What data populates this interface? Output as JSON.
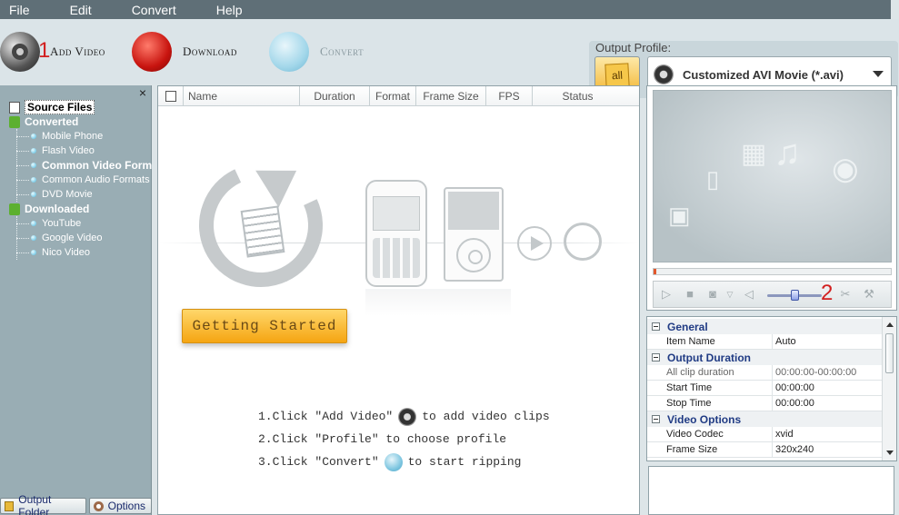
{
  "menu": {
    "items": [
      "File",
      "Edit",
      "Convert",
      "Help"
    ]
  },
  "toolbar": {
    "add_video_label": "Add Video",
    "add_video_step": "1",
    "download_label": "Download",
    "convert_label": "Convert"
  },
  "profile": {
    "caption": "Output Profile:",
    "all_button": "all",
    "selected": "Customized AVI Movie (*.avi)"
  },
  "sidebar": {
    "close": "×",
    "source_files": "Source Files",
    "converted": {
      "label": "Converted",
      "items": [
        "Mobile Phone",
        "Flash Video",
        "Common Video Form",
        "Common Audio Formats",
        "DVD Movie"
      ]
    },
    "downloaded": {
      "label": "Downloaded",
      "items": [
        "YouTube",
        "Google Video",
        "Nico Video"
      ]
    },
    "output_folder": "Output Folder",
    "options": "Options"
  },
  "file_list": {
    "columns": [
      "Name",
      "Duration",
      "Format",
      "Frame Size",
      "FPS",
      "Status"
    ]
  },
  "getting_started": "Getting Started",
  "instructions": {
    "step1_a": "1.Click \"Add Video\"",
    "step1_b": "to add video clips",
    "step2": "2.Click \"Profile\" to choose profile",
    "step3_a": "3.Click \"Convert\"",
    "step3_b": "to start ripping"
  },
  "preview": {
    "step_number": "2",
    "progress": 0.01,
    "volume": 0.5
  },
  "properties": {
    "general": {
      "title": "General",
      "rows": [
        {
          "key": "Item Name",
          "value": "Auto"
        }
      ]
    },
    "output_duration": {
      "title": "Output Duration",
      "rows": [
        {
          "key": "All clip duration",
          "value": "00:00:00-00:00:00"
        },
        {
          "key": "Start Time",
          "value": "00:00:00"
        },
        {
          "key": "Stop Time",
          "value": "00:00:00"
        }
      ]
    },
    "video_options": {
      "title": "Video Options",
      "rows": [
        {
          "key": "Video Codec",
          "value": "xvid"
        },
        {
          "key": "Frame Size",
          "value": "320x240"
        }
      ]
    }
  },
  "colors": {
    "menubar": "#5f6f77",
    "accent_orange": "#f5a512",
    "step_red": "#d21f1f",
    "section_blue": "#203b84"
  }
}
